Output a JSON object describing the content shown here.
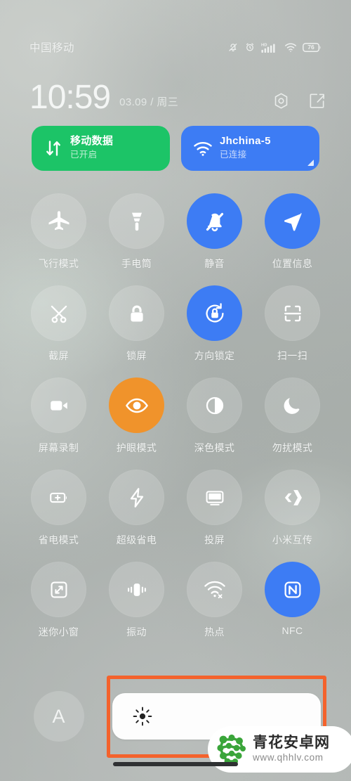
{
  "status_bar": {
    "carrier": "中国移动",
    "battery_percent": "76",
    "icons": [
      "bell-slash-icon",
      "alarm-icon",
      "hd-signal-icon",
      "wifi-icon",
      "battery-icon"
    ]
  },
  "header": {
    "time": "10:59",
    "date": "03.09 / 周三",
    "settings_icon": "gear-icon",
    "edit_icon": "edit-icon"
  },
  "big_tiles": [
    {
      "title": "移动数据",
      "subtitle": "已开启",
      "icon": "data-transfer-icon",
      "color": "#1cc467",
      "state": "on"
    },
    {
      "title": "Jhchina-5",
      "subtitle": "已连接",
      "icon": "wifi-icon",
      "color": "#3d7cf4",
      "state": "on"
    }
  ],
  "quick_settings": [
    {
      "label": "飞行模式",
      "icon": "airplane-icon",
      "state": "off"
    },
    {
      "label": "手电筒",
      "icon": "flashlight-icon",
      "state": "off"
    },
    {
      "label": "静音",
      "icon": "bell-slash-icon",
      "state": "on",
      "accent": "#3d7cf4"
    },
    {
      "label": "位置信息",
      "icon": "location-arrow-icon",
      "state": "on",
      "accent": "#3d7cf4"
    },
    {
      "label": "截屏",
      "icon": "screenshot-icon",
      "state": "off"
    },
    {
      "label": "锁屏",
      "icon": "lock-icon",
      "state": "off"
    },
    {
      "label": "方向锁定",
      "icon": "rotation-lock-icon",
      "state": "on",
      "accent": "#3d7cf4"
    },
    {
      "label": "扫一扫",
      "icon": "scan-icon",
      "state": "off"
    },
    {
      "label": "屏幕录制",
      "icon": "video-camera-icon",
      "state": "off"
    },
    {
      "label": "护眼模式",
      "icon": "eye-icon",
      "state": "on",
      "accent": "#f0932b"
    },
    {
      "label": "深色模式",
      "icon": "contrast-icon",
      "state": "off"
    },
    {
      "label": "勿扰模式",
      "icon": "moon-icon",
      "state": "off"
    },
    {
      "label": "省电模式",
      "icon": "battery-plus-icon",
      "state": "off"
    },
    {
      "label": "超级省电",
      "icon": "lightning-icon",
      "state": "off"
    },
    {
      "label": "投屏",
      "icon": "cast-screen-icon",
      "state": "off"
    },
    {
      "label": "小米互传",
      "icon": "mi-share-icon",
      "state": "off"
    },
    {
      "label": "迷你小窗",
      "icon": "mini-window-icon",
      "state": "off"
    },
    {
      "label": "振动",
      "icon": "vibrate-icon",
      "state": "off"
    },
    {
      "label": "热点",
      "icon": "hotspot-icon",
      "state": "off"
    },
    {
      "label": "NFC",
      "icon": "nfc-icon",
      "state": "on",
      "accent": "#3d7cf4"
    }
  ],
  "brightness": {
    "auto_label": "A",
    "auto_icon": "auto-brightness-icon",
    "slider_icon": "sun-icon",
    "slider_value_percent": "100"
  },
  "highlight": {
    "color": "#f4622c",
    "target": "brightness-slider"
  },
  "watermark": {
    "site_name": "青花安卓网",
    "url": "www.qhhlv.com",
    "logo": "molecule-logo-icon"
  }
}
